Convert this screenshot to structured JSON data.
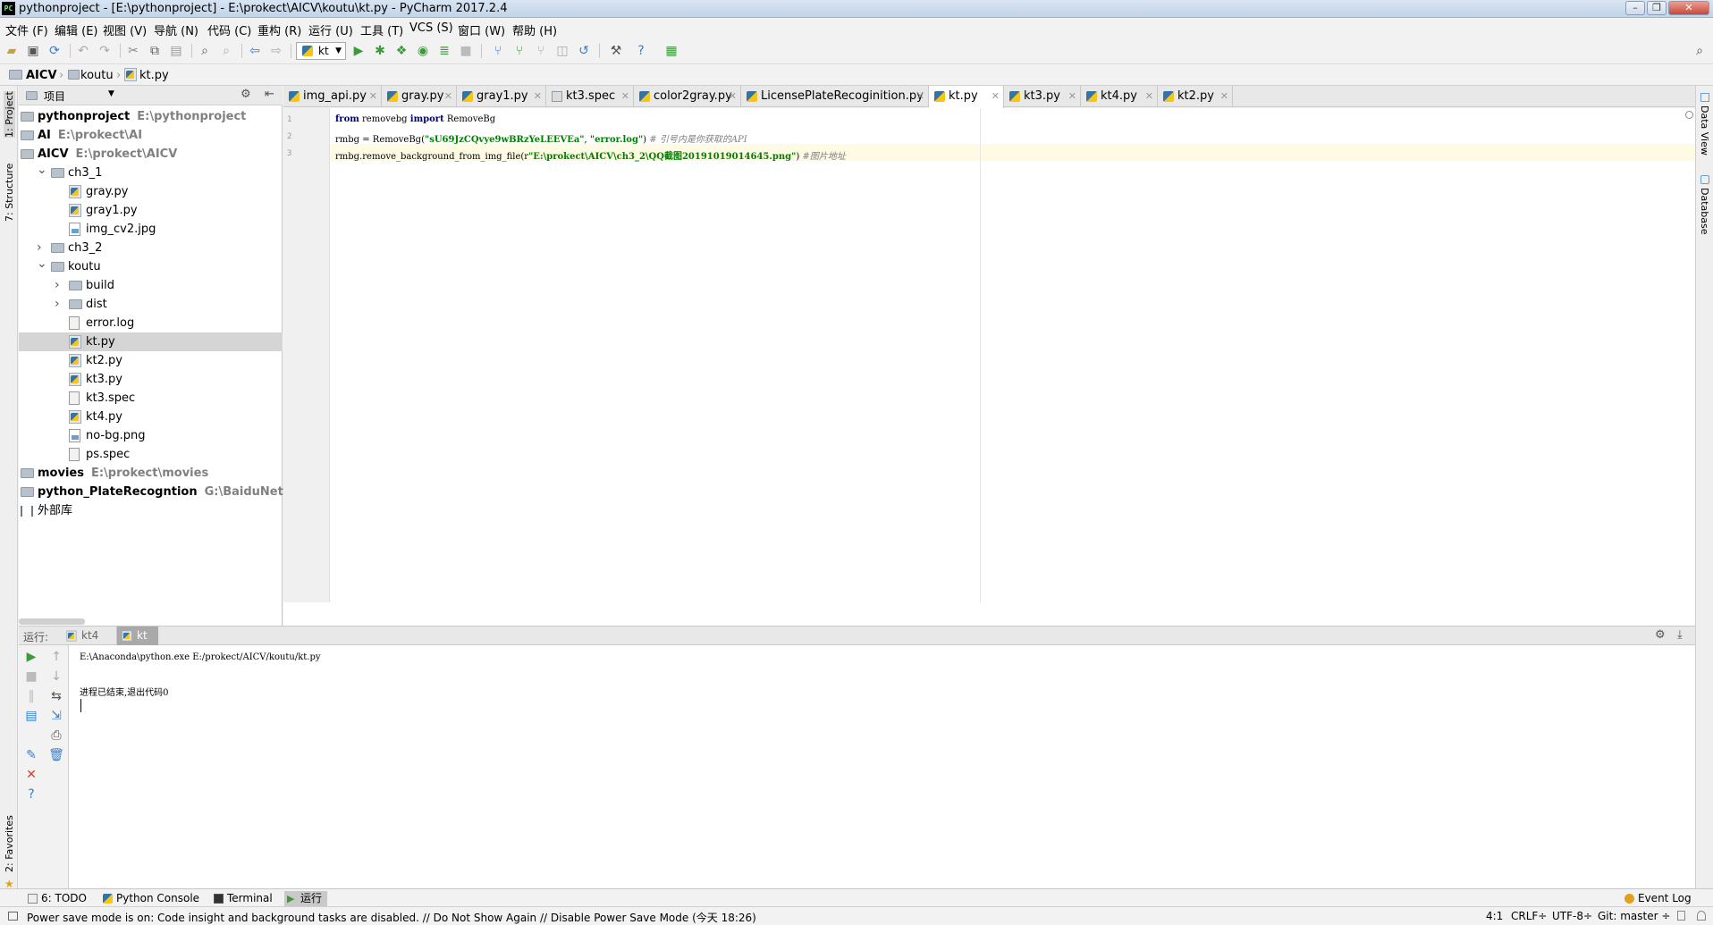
{
  "window": {
    "title": "pythonproject - [E:\\pythonproject] - E:\\prokect\\AICV\\koutu\\kt.py - PyCharm 2017.2.4",
    "logo": "PC"
  },
  "menu": [
    "文件 (F)",
    "编辑 (E)",
    "视图 (V)",
    "导航 (N)",
    "代码 (C)",
    "重构 (R)",
    "运行 (U)",
    "工具 (T)",
    "VCS (S)",
    "窗口 (W)",
    "帮助 (H)"
  ],
  "toolbar": {
    "run_config": "kt"
  },
  "breadcrumb": [
    "AICV",
    "koutu",
    "kt.py"
  ],
  "project_panel": {
    "title": "项目",
    "tree": [
      {
        "label": "pythonproject",
        "path": "E:\\pythonproject",
        "bold": true,
        "type": "folder",
        "indent": 0,
        "arrow": ""
      },
      {
        "label": "AI",
        "path": "E:\\prokect\\AI",
        "bold": true,
        "type": "folder",
        "indent": 0,
        "arrow": ""
      },
      {
        "label": "AICV",
        "path": "E:\\prokect\\AICV",
        "bold": true,
        "type": "folder",
        "indent": 0,
        "arrow": ""
      },
      {
        "label": "ch3_1",
        "path": "",
        "bold": false,
        "type": "folder",
        "indent": 1,
        "arrow": "v"
      },
      {
        "label": "gray.py",
        "path": "",
        "bold": false,
        "type": "py",
        "indent": 2,
        "arrow": ""
      },
      {
        "label": "gray1.py",
        "path": "",
        "bold": false,
        "type": "py",
        "indent": 2,
        "arrow": ""
      },
      {
        "label": "img_cv2.jpg",
        "path": "",
        "bold": false,
        "type": "img",
        "indent": 2,
        "arrow": ""
      },
      {
        "label": "ch3_2",
        "path": "",
        "bold": false,
        "type": "folder",
        "indent": 1,
        "arrow": ">"
      },
      {
        "label": "koutu",
        "path": "",
        "bold": false,
        "type": "folder",
        "indent": 1,
        "arrow": "v"
      },
      {
        "label": "build",
        "path": "",
        "bold": false,
        "type": "folder",
        "indent": 2,
        "arrow": ">"
      },
      {
        "label": "dist",
        "path": "",
        "bold": false,
        "type": "folder",
        "indent": 2,
        "arrow": ">"
      },
      {
        "label": "error.log",
        "path": "",
        "bold": false,
        "type": "plain",
        "indent": 2,
        "arrow": ""
      },
      {
        "label": "kt.py",
        "path": "",
        "bold": false,
        "type": "py",
        "indent": 2,
        "arrow": "",
        "selected": true
      },
      {
        "label": "kt2.py",
        "path": "",
        "bold": false,
        "type": "py",
        "indent": 2,
        "arrow": ""
      },
      {
        "label": "kt3.py",
        "path": "",
        "bold": false,
        "type": "py",
        "indent": 2,
        "arrow": ""
      },
      {
        "label": "kt3.spec",
        "path": "",
        "bold": false,
        "type": "plain",
        "indent": 2,
        "arrow": ""
      },
      {
        "label": "kt4.py",
        "path": "",
        "bold": false,
        "type": "py",
        "indent": 2,
        "arrow": ""
      },
      {
        "label": "no-bg.png",
        "path": "",
        "bold": false,
        "type": "img",
        "indent": 2,
        "arrow": ""
      },
      {
        "label": "ps.spec",
        "path": "",
        "bold": false,
        "type": "plain",
        "indent": 2,
        "arrow": ""
      },
      {
        "label": "movies",
        "path": "E:\\prokect\\movies",
        "bold": true,
        "type": "folder",
        "indent": 0,
        "arrow": ""
      },
      {
        "label": "python_PlateRecogntion",
        "path": "G:\\BaiduNetdiskDov",
        "bold": true,
        "type": "folder",
        "indent": 0,
        "arrow": ""
      },
      {
        "label": "外部库",
        "path": "",
        "bold": false,
        "type": "libs",
        "indent": 0,
        "arrow": ""
      }
    ]
  },
  "tabs": [
    {
      "label": "img_api.py",
      "type": "py"
    },
    {
      "label": "gray.py",
      "type": "py"
    },
    {
      "label": "gray1.py",
      "type": "py"
    },
    {
      "label": "kt3.spec",
      "type": "plain"
    },
    {
      "label": "color2gray.py",
      "type": "py"
    },
    {
      "label": "LicensePlateRecoginition.py",
      "type": "py"
    },
    {
      "label": "kt.py",
      "type": "py",
      "active": true
    },
    {
      "label": "kt3.py",
      "type": "py"
    },
    {
      "label": "kt4.py",
      "type": "py"
    },
    {
      "label": "kt2.py",
      "type": "py"
    }
  ],
  "editor": {
    "lines": [
      {
        "num": "1",
        "parts": [
          {
            "t": "from",
            "c": "kw"
          },
          {
            "t": " removebg ",
            "c": ""
          },
          {
            "t": "import",
            "c": "kw"
          },
          {
            "t": " RemoveBg",
            "c": ""
          }
        ]
      },
      {
        "num": "2",
        "parts": [
          {
            "t": "rmbg = RemoveBg(",
            "c": ""
          },
          {
            "t": "\"sU69JzCQvye9wBRzYeLEEVEa\"",
            "c": "str"
          },
          {
            "t": ", ",
            "c": ""
          },
          {
            "t": "\"error.log\"",
            "c": "str"
          },
          {
            "t": ") ",
            "c": ""
          },
          {
            "t": "# 引号内是你获取的API",
            "c": "cm"
          }
        ]
      },
      {
        "num": "3",
        "parts": [
          {
            "t": "rmbg.remove_background_from_img_file(r",
            "c": ""
          },
          {
            "t": "\"E:\\prokect\\AICV\\ch3_2\\QQ截图20191019014645.png\"",
            "c": "str"
          },
          {
            "t": ") ",
            "c": ""
          },
          {
            "t": "#图片地址",
            "c": "cm"
          }
        ]
      }
    ]
  },
  "run_panel": {
    "label": "运行:",
    "tabs": [
      "kt4",
      "kt"
    ],
    "output": [
      "E:\\Anaconda\\python.exe E:/prokect/AICV/koutu/kt.py",
      "",
      "进程已结束,退出代码0"
    ]
  },
  "side_labels": {
    "left_top": [
      "1: Project",
      "7: Structure"
    ],
    "left_bottom": "2: Favorites",
    "right": [
      "Data View",
      "Database"
    ]
  },
  "bottom_tabs": [
    {
      "label": "6: TODO"
    },
    {
      "label": "Python Console"
    },
    {
      "label": "Terminal"
    },
    {
      "label": "运行",
      "active": true
    }
  ],
  "event_log": "Event Log",
  "status": {
    "message": "Power save mode is on: Code insight and background tasks are disabled. // Do Not Show Again // Disable Power Save Mode (今天 18:26)",
    "position": "4:1",
    "line_sep": "CRLF÷",
    "encoding": "UTF-8÷",
    "git": "Git: master ÷"
  }
}
